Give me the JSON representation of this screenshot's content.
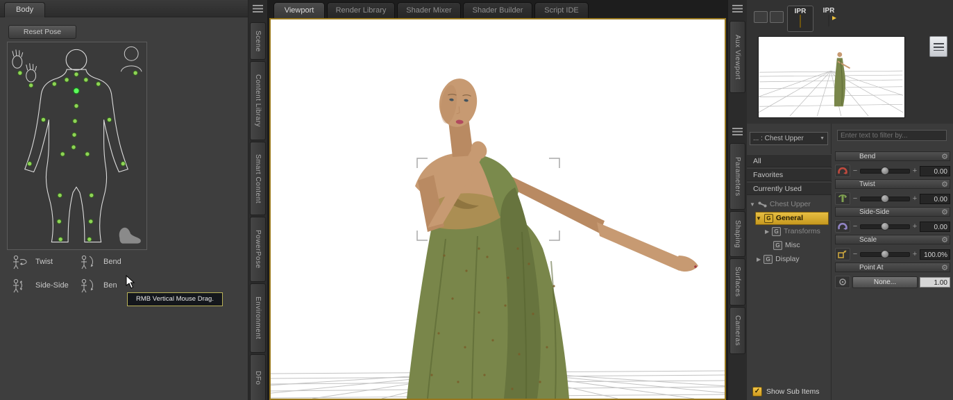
{
  "colors": {
    "accent": "#d7a22b",
    "viewport_border": "#97771d",
    "highlight_row": "#d2a02a",
    "bend_icon": "#c04a3e",
    "twist_icon": "#7fa050",
    "side_icon": "#9184c4",
    "scale_icon": "#caa53e"
  },
  "icons": {
    "dropdown_arrow": "▼",
    "expanded": "▼",
    "collapsed": "▶",
    "gear": "⚙",
    "check": "✓",
    "group": "G",
    "minus": "−",
    "plus": "+"
  },
  "left_panel": {
    "tab": "Body",
    "reset_button": "Reset Pose",
    "controls": [
      {
        "label": "Twist"
      },
      {
        "label": "Bend"
      },
      {
        "label": "Side-Side"
      },
      {
        "label": "Ben"
      }
    ],
    "tooltip": "RMB Vertical Mouse Drag."
  },
  "left_tabs": [
    {
      "label": "Scene"
    },
    {
      "label": "Content Library"
    },
    {
      "label": "Smart Content"
    },
    {
      "label": "PowerPose"
    },
    {
      "label": "Environment"
    },
    {
      "label": "DFo"
    }
  ],
  "center_tabs": [
    {
      "label": "Viewport"
    },
    {
      "label": "Render Library"
    },
    {
      "label": "Shader Mixer"
    },
    {
      "label": "Shader Builder"
    },
    {
      "label": "Script IDE"
    }
  ],
  "right_tabs": [
    {
      "label": "Aux Viewport"
    },
    {
      "label": "Parameters"
    },
    {
      "label": "Shaping"
    },
    {
      "label": "Surfaces"
    },
    {
      "label": "Cameras"
    }
  ],
  "aux": {
    "ipr_button": "IPR",
    "ipr_render_button": "IPR"
  },
  "parameters": {
    "selector": "... : Chest Upper",
    "filter_placeholder": "Enter text to filter by...",
    "groups": [
      {
        "label": "All"
      },
      {
        "label": "Favorites"
      },
      {
        "label": "Currently Used"
      }
    ],
    "tree": {
      "root": "Chest Upper",
      "general": "General",
      "transforms": "Transforms",
      "misc": "Misc",
      "display": "Display"
    },
    "sliders": [
      {
        "label": "Bend",
        "value": "0.00"
      },
      {
        "label": "Twist",
        "value": "0.00"
      },
      {
        "label": "Side-Side",
        "value": "0.00"
      },
      {
        "label": "Scale",
        "value": "100.0%"
      },
      {
        "label": "Point At",
        "button": "None...",
        "value": "1.00"
      }
    ],
    "show_sub_items": "Show Sub Items"
  }
}
